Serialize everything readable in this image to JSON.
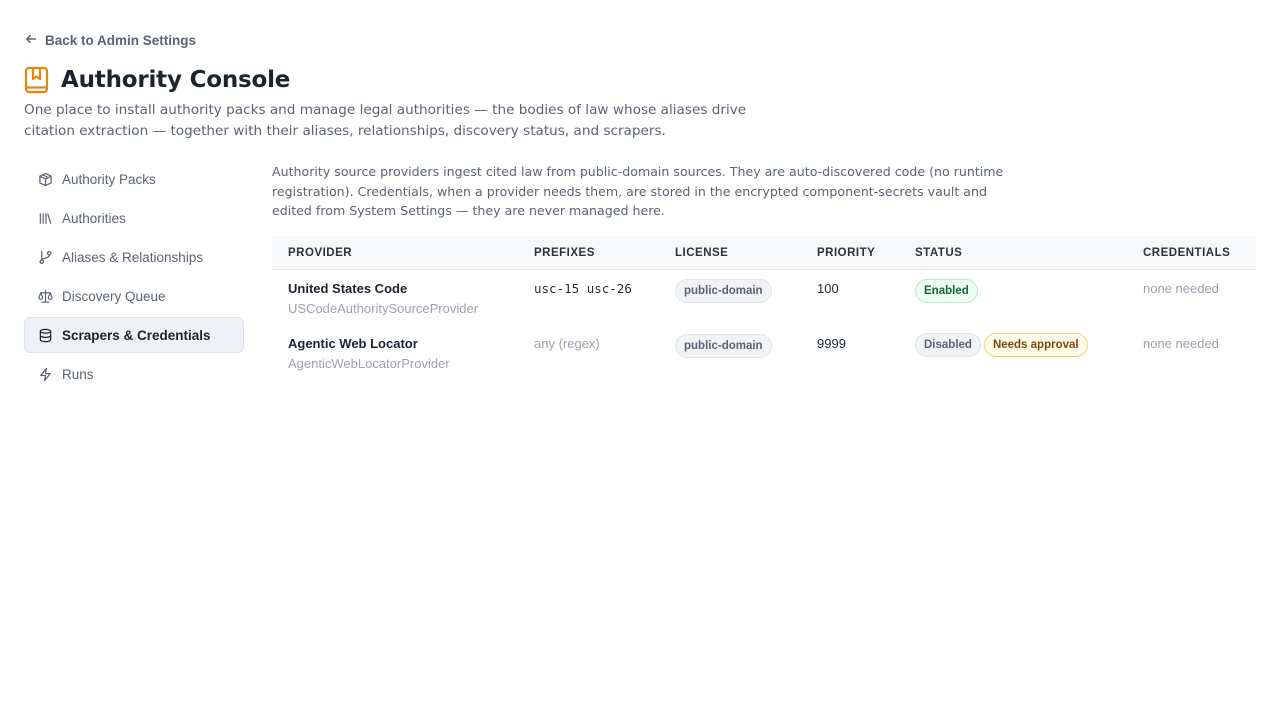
{
  "nav": {
    "back_label": "Back to Admin Settings"
  },
  "header": {
    "title": "Authority Console",
    "subtitle": "One place to install authority packs and manage legal authorities — the bodies of law whose aliases drive citation extraction — together with their aliases, relationships, discovery status, and scrapers.",
    "accent_color": "#e0890f"
  },
  "sidebar": {
    "items": [
      {
        "label": "Authority Packs",
        "icon": "package-icon"
      },
      {
        "label": "Authorities",
        "icon": "library-icon"
      },
      {
        "label": "Aliases & Relationships",
        "icon": "git-branch-icon"
      },
      {
        "label": "Discovery Queue",
        "icon": "scale-icon"
      },
      {
        "label": "Scrapers & Credentials",
        "icon": "database-icon",
        "active": true
      },
      {
        "label": "Runs",
        "icon": "lightning-icon"
      }
    ]
  },
  "main": {
    "description": "Authority source providers ingest cited law from public-domain sources. They are auto-discovered code (no runtime registration). Credentials, when a provider needs them, are stored in the encrypted component-secrets vault and edited from System Settings — they are never managed here.",
    "table": {
      "headers": [
        "PROVIDER",
        "PREFIXES",
        "LICENSE",
        "PRIORITY",
        "STATUS",
        "CREDENTIALS"
      ],
      "rows": [
        {
          "name": "United States Code",
          "class_name": "USCodeAuthoritySourceProvider",
          "prefix_1": "usc-15",
          "prefix_2": "usc-26",
          "license": "public-domain",
          "priority": "100",
          "status": "Enabled",
          "credentials": "none needed"
        },
        {
          "name": "Agentic Web Locator",
          "class_name": "AgenticWebLocatorProvider",
          "prefix": "any (regex)",
          "license": "public-domain",
          "priority": "9999",
          "status": "Disabled",
          "status_extra": "Needs approval",
          "credentials": "none needed"
        }
      ]
    }
  }
}
